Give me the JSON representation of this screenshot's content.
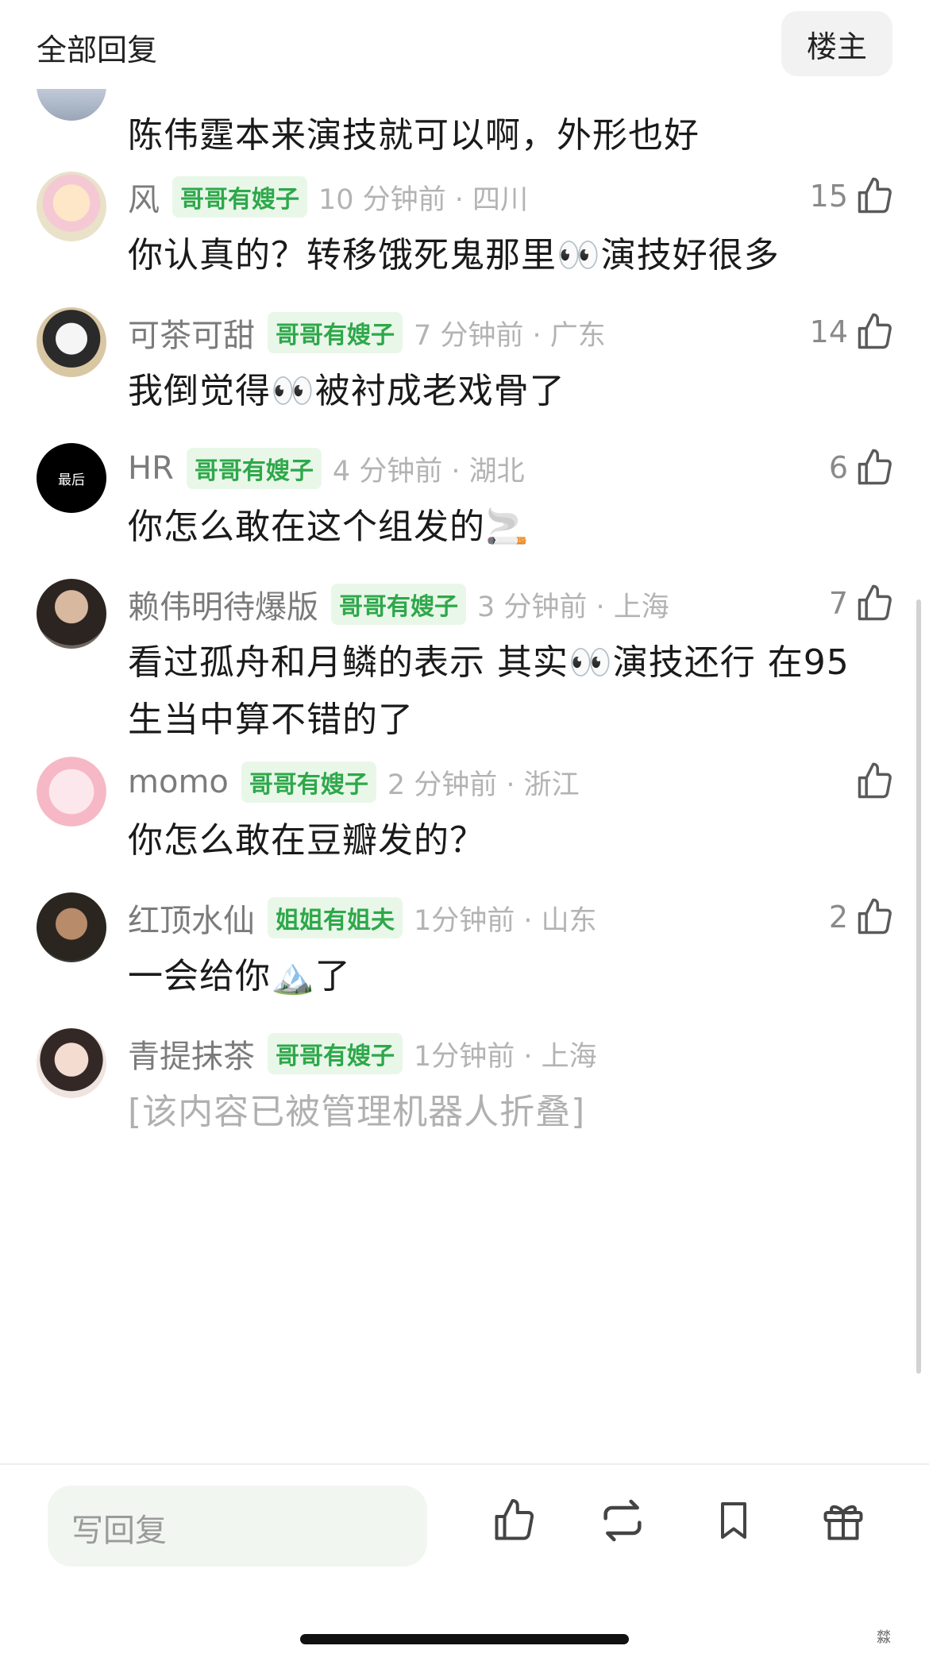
{
  "header": {
    "title": "全部回复",
    "owner_button": "楼主"
  },
  "top_partial": {
    "content": "陈伟霆本来演技就可以啊，外形也好"
  },
  "comments": [
    {
      "username": "风",
      "badge": "哥哥有嫂子",
      "meta": "10 分钟前 · 四川",
      "likes": "15",
      "content": "你认真的？转移饿死鬼那里👀演技好很多"
    },
    {
      "username": "可茶可甜",
      "badge": "哥哥有嫂子",
      "meta": "7 分钟前 · 广东",
      "likes": "14",
      "content": "我倒觉得👀被衬成老戏骨了"
    },
    {
      "username": "HR",
      "avatar_text": "最后",
      "badge": "哥哥有嫂子",
      "meta": "4 分钟前 · 湖北",
      "likes": "6",
      "content": "你怎么敢在这个组发的🚬"
    },
    {
      "username": "赖伟明待爆版",
      "badge": "哥哥有嫂子",
      "meta": "3 分钟前 · 上海",
      "likes": "7",
      "content": "看过孤舟和月鳞的表示 其实👀演技还行 在95生当中算不错的了"
    },
    {
      "username": "momo",
      "badge": "哥哥有嫂子",
      "meta": "2 分钟前 · 浙江",
      "likes": "",
      "content": "你怎么敢在豆瓣发的？"
    },
    {
      "username": "红顶水仙",
      "badge": "姐姐有姐夫",
      "meta": "1分钟前 · 山东",
      "likes": "2",
      "content": "一会给你🏔️了"
    },
    {
      "username": "青提抹茶",
      "badge": "哥哥有嫂子",
      "meta": "1分钟前 · 上海",
      "likes": "",
      "content": "[该内容已被管理机器人折叠]"
    }
  ],
  "bottom_bar": {
    "reply_placeholder": "写回复"
  },
  "icons": {
    "like": "thumbs-up-icon",
    "repost": "repost-icon",
    "bookmark": "bookmark-icon",
    "gift": "gift-icon"
  },
  "watermark": "㵘"
}
